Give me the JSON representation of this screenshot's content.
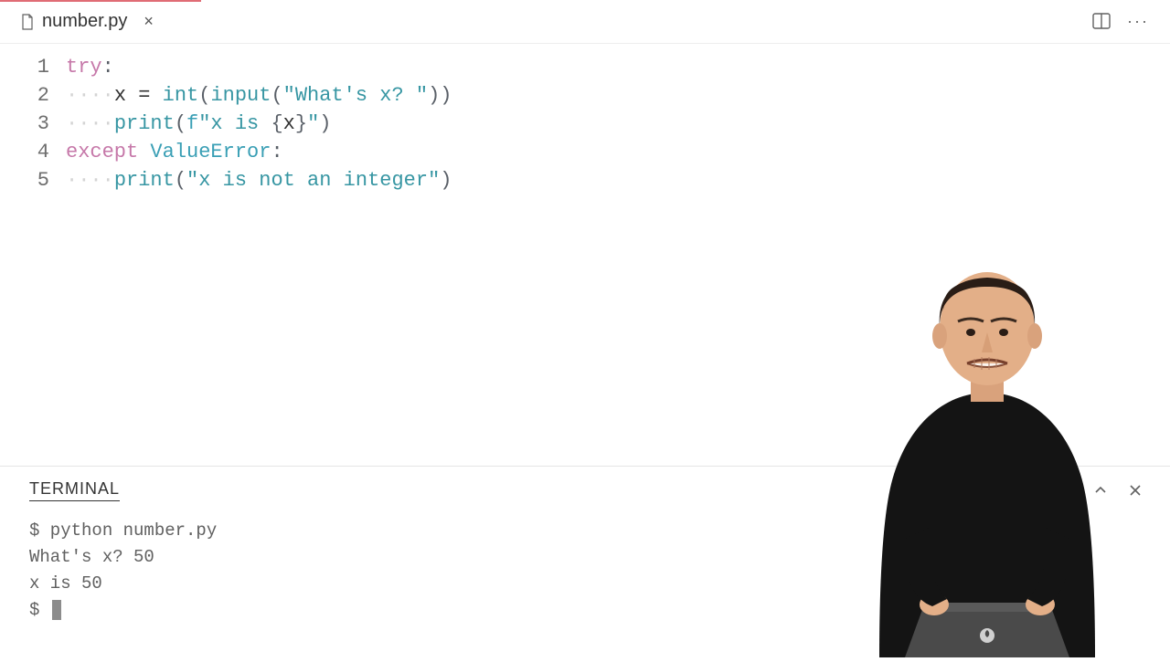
{
  "tab": {
    "filename": "number.py",
    "close_tooltip": "Close"
  },
  "header_icons": {
    "split": "split-editor-icon",
    "more": "more-icon"
  },
  "code": {
    "lines": [
      {
        "num": "1",
        "tokens": [
          {
            "t": "kw",
            "v": "try"
          },
          {
            "t": "punct",
            "v": ":"
          }
        ]
      },
      {
        "num": "2",
        "tokens": [
          {
            "t": "ws",
            "v": "····"
          },
          {
            "t": "id",
            "v": "x "
          },
          {
            "t": "op",
            "v": "= "
          },
          {
            "t": "fn",
            "v": "int"
          },
          {
            "t": "punct",
            "v": "("
          },
          {
            "t": "fn",
            "v": "input"
          },
          {
            "t": "punct",
            "v": "("
          },
          {
            "t": "str",
            "v": "\"What's x? \""
          },
          {
            "t": "punct",
            "v": "))"
          }
        ]
      },
      {
        "num": "3",
        "tokens": [
          {
            "t": "ws",
            "v": "····"
          },
          {
            "t": "fn",
            "v": "print"
          },
          {
            "t": "punct",
            "v": "("
          },
          {
            "t": "kw2",
            "v": "f"
          },
          {
            "t": "str",
            "v": "\"x is "
          },
          {
            "t": "punct",
            "v": "{"
          },
          {
            "t": "id",
            "v": "x"
          },
          {
            "t": "punct",
            "v": "}"
          },
          {
            "t": "str",
            "v": "\""
          },
          {
            "t": "punct",
            "v": ")"
          }
        ]
      },
      {
        "num": "4",
        "tokens": [
          {
            "t": "kw",
            "v": "except"
          },
          {
            "t": "id",
            "v": " "
          },
          {
            "t": "kw2",
            "v": "ValueError"
          },
          {
            "t": "punct",
            "v": ":"
          }
        ]
      },
      {
        "num": "5",
        "tokens": [
          {
            "t": "ws",
            "v": "····"
          },
          {
            "t": "fn",
            "v": "print"
          },
          {
            "t": "punct",
            "v": "("
          },
          {
            "t": "str",
            "v": "\"x is not an integer\""
          },
          {
            "t": "punct",
            "v": ")"
          }
        ]
      }
    ]
  },
  "terminal": {
    "title": "TERMINAL",
    "lines": [
      "$ python number.py",
      "What's x? 50",
      "x is 50",
      "$ "
    ]
  },
  "colors": {
    "keyword": "#c678a9",
    "builtin": "#3a9fb5",
    "string": "#3796a3",
    "text": "#333333",
    "whitespace": "#d4d4d4"
  }
}
